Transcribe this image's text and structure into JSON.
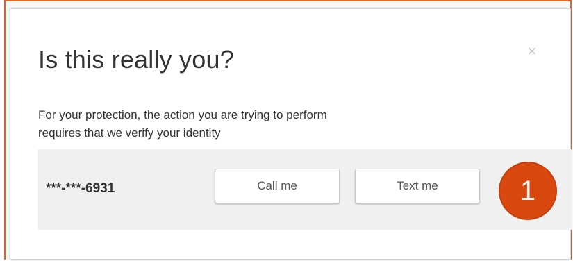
{
  "dialog": {
    "title": "Is this really you?",
    "close_glyph": "×",
    "description_line1": "For your protection, the action you are trying to perform",
    "description_line2": "requires that we verify your identity"
  },
  "verification": {
    "phone_masked": "***-***-6931",
    "call_button_label": "Call me",
    "text_button_label": "Text me"
  },
  "annotation": {
    "step_number": "1"
  },
  "colors": {
    "accent": "#d9480f",
    "frame_border": "#d9662a",
    "panel_bg": "#f0f0f0"
  }
}
